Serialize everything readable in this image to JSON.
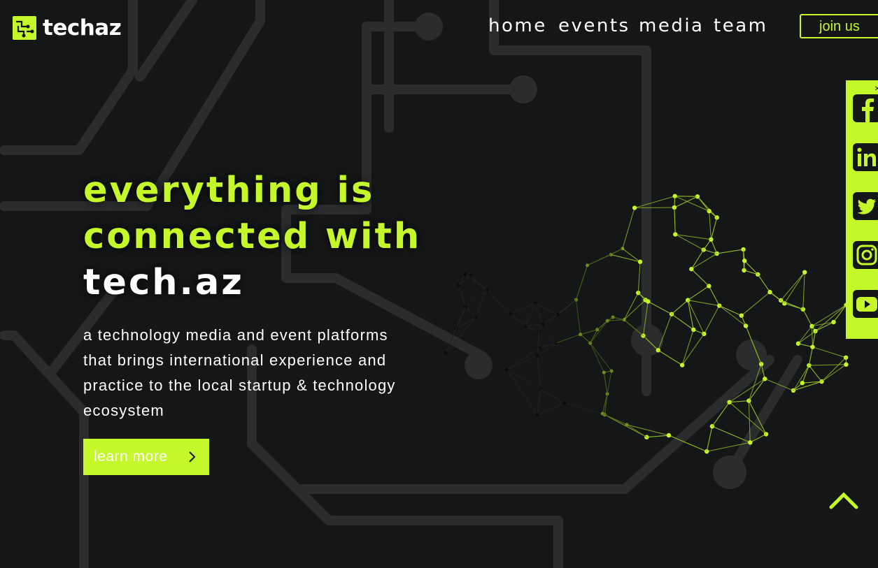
{
  "brand": {
    "name": "techaz",
    "accent": "#c4f82a",
    "background": "#151618"
  },
  "nav": {
    "items": [
      {
        "label": "home"
      },
      {
        "label": "events"
      },
      {
        "label": "media"
      },
      {
        "label": "team"
      }
    ],
    "join_label": "join us"
  },
  "hero": {
    "line1": "everything is",
    "line2": "connected with",
    "line3": "tech.az",
    "description": "a technology media and event platforms that brings international experience and practice to the local startup & technology ecosystem",
    "cta_label": "learn more"
  },
  "social": {
    "close_glyph": "×",
    "icons": [
      "facebook-icon",
      "linkedin-icon",
      "twitter-icon",
      "instagram-icon",
      "youtube-icon"
    ]
  },
  "scroll_top": {
    "icon": "chevron-up-icon"
  }
}
